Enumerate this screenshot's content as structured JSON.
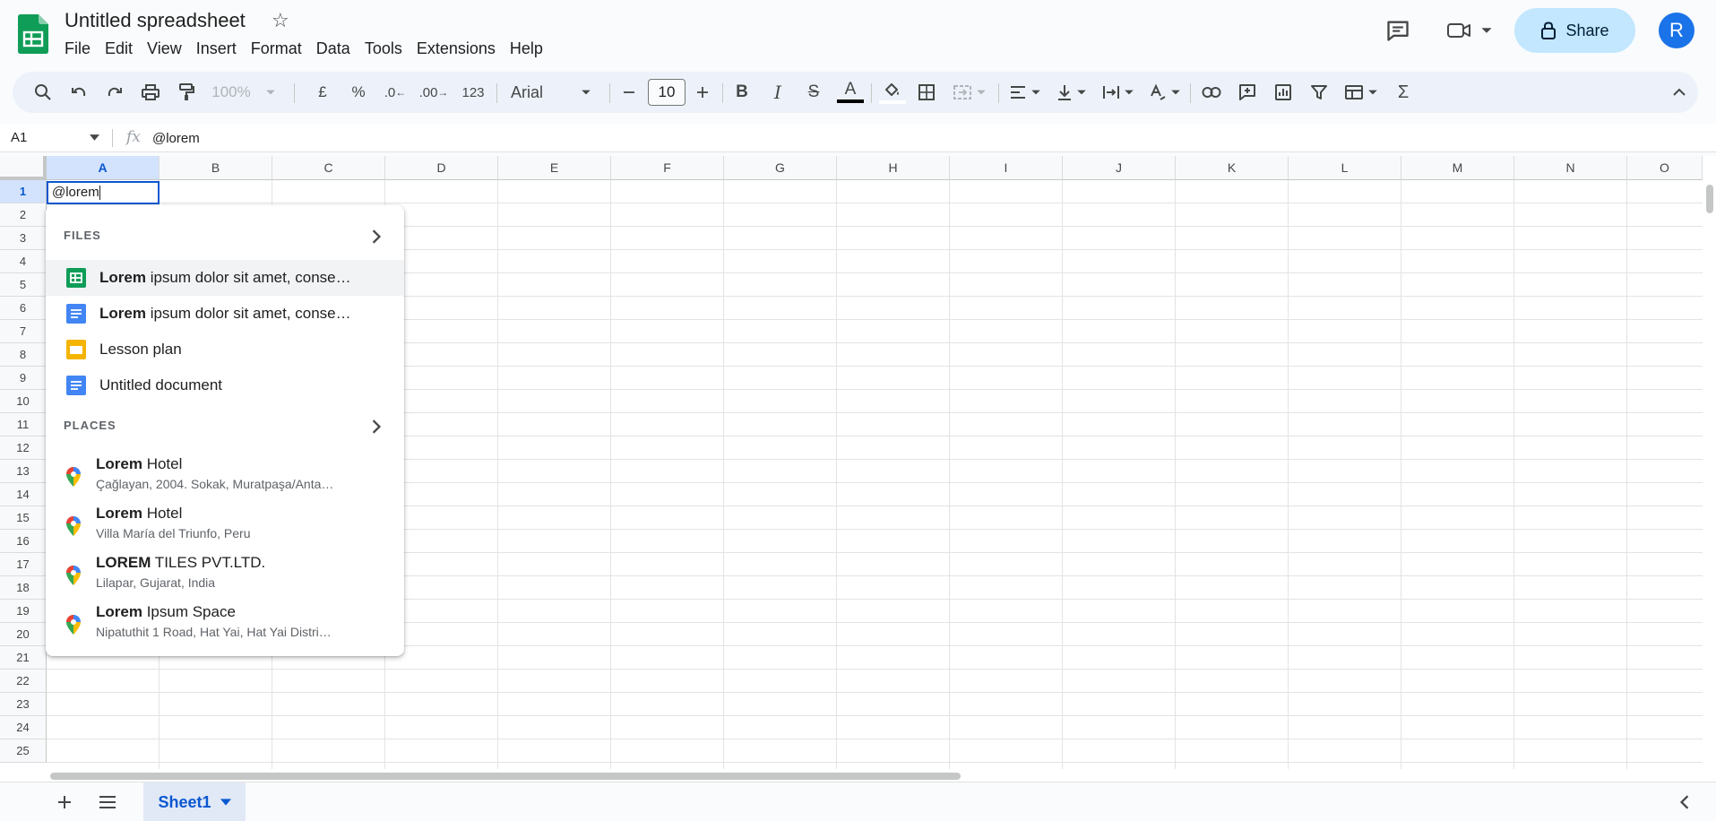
{
  "document": {
    "title": "Untitled spreadsheet"
  },
  "menu": [
    "File",
    "Edit",
    "View",
    "Insert",
    "Format",
    "Data",
    "Tools",
    "Extensions",
    "Help"
  ],
  "header": {
    "share_label": "Share",
    "avatar_letter": "R"
  },
  "toolbar": {
    "zoom": "100%",
    "currency_symbol": "£",
    "percent_symbol": "%",
    "decrease_decimal": ".0",
    "increase_decimal": ".00",
    "number_format": "123",
    "font_family": "Arial",
    "font_size": "10",
    "text_color": "#000000"
  },
  "formula_bar": {
    "cell_ref": "A1",
    "content": "@lorem"
  },
  "grid": {
    "columns": [
      "A",
      "B",
      "C",
      "D",
      "E",
      "F",
      "G",
      "H",
      "I",
      "J",
      "K",
      "L",
      "M",
      "N",
      "O"
    ],
    "rows": [
      "1",
      "2",
      "3",
      "4",
      "5",
      "6",
      "7",
      "8",
      "9",
      "10",
      "11",
      "12",
      "13",
      "14",
      "15",
      "16",
      "17",
      "18",
      "19",
      "20",
      "21",
      "22",
      "23",
      "24",
      "25"
    ],
    "active_cell_value": "@lorem"
  },
  "dropdown": {
    "files_heading": "FILES",
    "files": [
      {
        "bold": "Lorem",
        "rest": " ipsum dolor sit amet, conse…",
        "icon": "sheets-icon"
      },
      {
        "bold": "Lorem",
        "rest": " ipsum dolor sit amet, conse…",
        "icon": "docs-icon"
      },
      {
        "bold": "",
        "rest": "Lesson plan",
        "icon": "slides-icon"
      },
      {
        "bold": "",
        "rest": "Untitled document",
        "icon": "docs-icon"
      }
    ],
    "places_heading": "PLACES",
    "places": [
      {
        "bold": "Lorem",
        "rest": " Hotel",
        "address": "Çağlayan, 2004. Sokak, Muratpaşa/Anta…"
      },
      {
        "bold": "Lorem",
        "rest": " Hotel",
        "address": "Villa María del Triunfo, Peru"
      },
      {
        "bold": "LOREM",
        "rest": " TILES PVT.LTD.",
        "address": "Lilapar, Gujarat, India"
      },
      {
        "bold": "Lorem",
        "rest": " Ipsum Space",
        "address": "Nipatuthit 1 Road, Hat Yai, Hat Yai Distri…"
      }
    ]
  },
  "sheets": [
    {
      "name": "Sheet1"
    }
  ],
  "colors": {
    "accent": "#0b57d0",
    "share_bg": "#c2e7ff",
    "sheets_green": "#0f9d58",
    "docs_blue": "#4285f4",
    "slides_yellow": "#f4b400"
  }
}
